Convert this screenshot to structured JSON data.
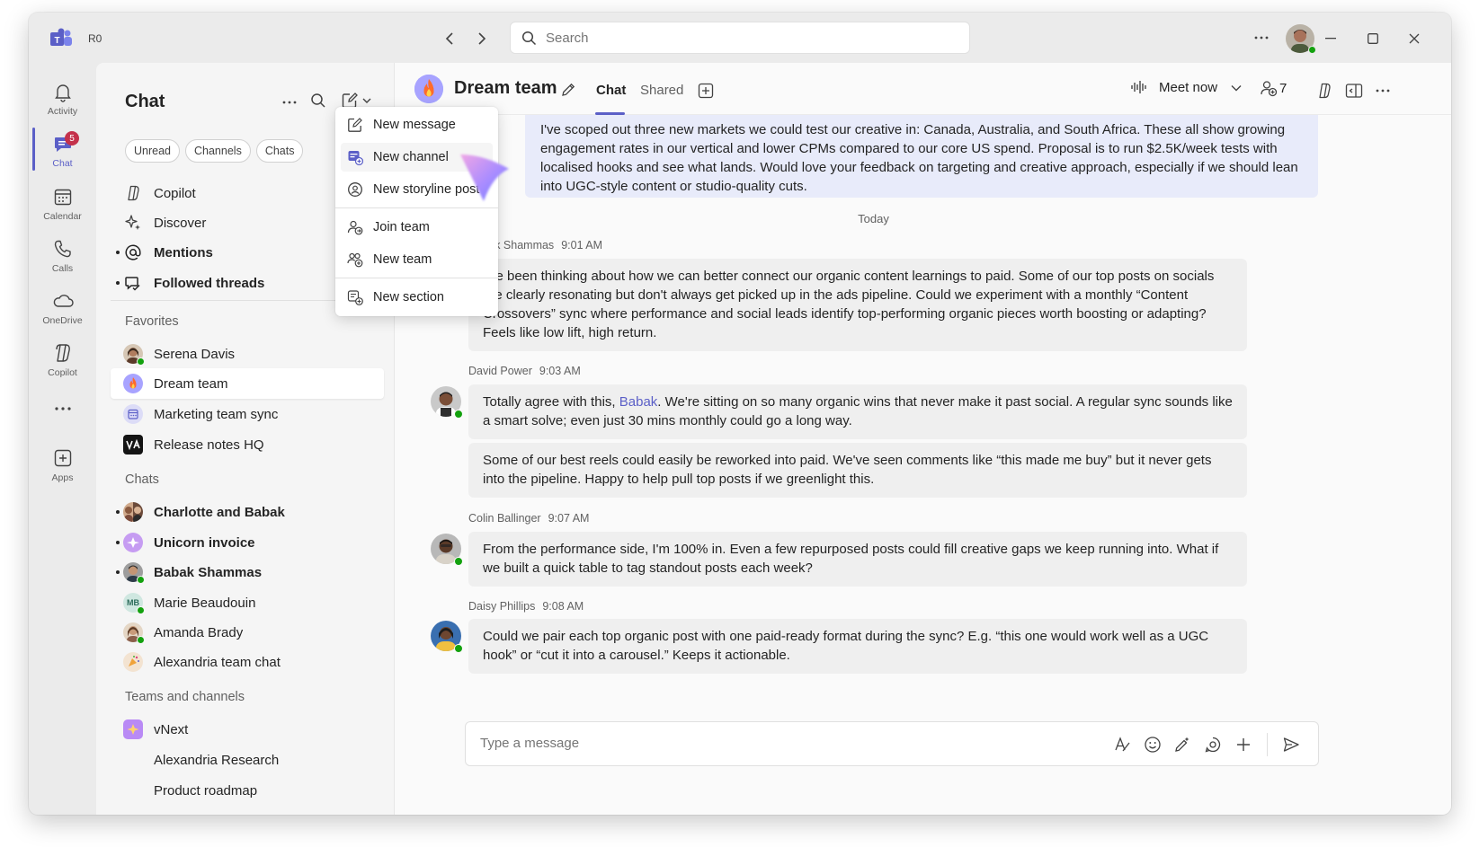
{
  "titlebar": {
    "org_badge": "R0",
    "search_placeholder": "Search"
  },
  "rail": [
    {
      "label": "Activity",
      "icon": "bell-icon"
    },
    {
      "label": "Chat",
      "icon": "chat-icon",
      "badge": "5",
      "active": true
    },
    {
      "label": "Calendar",
      "icon": "calendar-icon"
    },
    {
      "label": "Calls",
      "icon": "phone-icon"
    },
    {
      "label": "OneDrive",
      "icon": "cloud-icon"
    },
    {
      "label": "Copilot",
      "icon": "copilot-icon"
    },
    {
      "label": "Apps",
      "icon": "apps-plus-icon"
    }
  ],
  "list": {
    "title": "Chat",
    "filters": [
      "Unread",
      "Channels",
      "Chats"
    ],
    "top_items": [
      {
        "label": "Copilot",
        "icon": "copilot-icon"
      },
      {
        "label": "Discover",
        "icon": "sparkle-icon"
      },
      {
        "label": "Mentions",
        "icon": "at-icon",
        "bold": true,
        "dot": true
      },
      {
        "label": "Followed threads",
        "icon": "followed-threads-icon",
        "bold": true,
        "dot": true
      }
    ],
    "favorites_label": "Favorites",
    "favorites": [
      {
        "label": "Serena Davis"
      },
      {
        "label": "Dream team",
        "selected": true
      },
      {
        "label": "Marketing team sync"
      },
      {
        "label": "Release notes HQ"
      }
    ],
    "chats_label": "Chats",
    "chats": [
      {
        "label": "Charlotte and Babak",
        "bold": true,
        "dot": true
      },
      {
        "label": "Unicorn invoice",
        "bold": true,
        "dot": true
      },
      {
        "label": "Babak Shammas",
        "bold": true,
        "dot": true
      },
      {
        "label": "Marie Beaudouin",
        "initials": "MB"
      },
      {
        "label": "Amanda Brady"
      },
      {
        "label": "Alexandria team chat"
      }
    ],
    "teams_label": "Teams and channels",
    "teams": [
      {
        "label": "vNext"
      },
      {
        "label": "Alexandria Research"
      },
      {
        "label": "Product roadmap"
      }
    ]
  },
  "menu": {
    "items": [
      {
        "label": "New message",
        "icon": "compose-icon"
      },
      {
        "label": "New channel",
        "icon": "new-channel-icon"
      },
      {
        "label": "New storyline post",
        "icon": "storyline-icon"
      },
      {
        "label": "Join team",
        "icon": "join-team-icon"
      },
      {
        "label": "New team",
        "icon": "new-team-icon"
      },
      {
        "label": "New section",
        "icon": "new-section-icon"
      }
    ]
  },
  "conversation": {
    "title": "Dream team",
    "tabs": [
      "Chat",
      "Shared"
    ],
    "meet_now": "Meet now",
    "participants": "7",
    "own_message": "I've scoped out three new markets we could test our creative in: Canada, Australia, and South Africa. These all show growing engagement rates in our vertical and lower CPMs compared to our core US spend. Proposal is to run $2.5K/week tests with localised hooks and see what lands. Would love your feedback on targeting and creative approach, especially if we should lean into UGC-style content or studio-quality cuts.",
    "date_divider": "Today",
    "messages": [
      {
        "author": "Babak Shammas",
        "time": "9:01 AM",
        "paragraphs": [
          "I've been thinking about how we can better connect our organic content learnings to paid. Some of our top posts on socials are clearly resonating but don't always get picked up in the ads pipeline. Could we experiment with a monthly “Content Crossovers” sync where performance and social leads identify top-performing organic pieces worth boosting or adapting? Feels like low lift, high return."
        ]
      },
      {
        "author": "David Power",
        "time": "9:03 AM",
        "pre": "Totally agree with this, ",
        "mention": "Babak",
        "post": ". We're sitting on so many organic wins that never make it past social. A regular sync sounds like a smart solve; even just 30 mins monthly could go a long way.",
        "second": "Some of our best reels could easily be reworked into paid. We've seen comments like “this made me buy” but it never gets into the pipeline. Happy to help pull top posts if we greenlight this."
      },
      {
        "author": "Colin Ballinger",
        "time": "9:07 AM",
        "paragraphs": [
          "From the performance side, I'm 100% in. Even a few repurposed posts could fill creative gaps we keep running into. What if we built a quick table to tag standout posts each week?"
        ]
      },
      {
        "author": "Daisy Phillips",
        "time": "9:08 AM",
        "paragraphs": [
          "Could we pair each top organic post with one paid-ready format during the sync? E.g. “this one would work well as a UGC hook” or “cut it into a carousel.” Keeps it actionable."
        ]
      }
    ],
    "composer_placeholder": "Type a message"
  },
  "colors": {
    "accent": "#5b5fc7",
    "badge": "#c4314b",
    "presence": "#13a10e",
    "own_bubble": "#e8ebfa",
    "bubble": "#efefef"
  }
}
